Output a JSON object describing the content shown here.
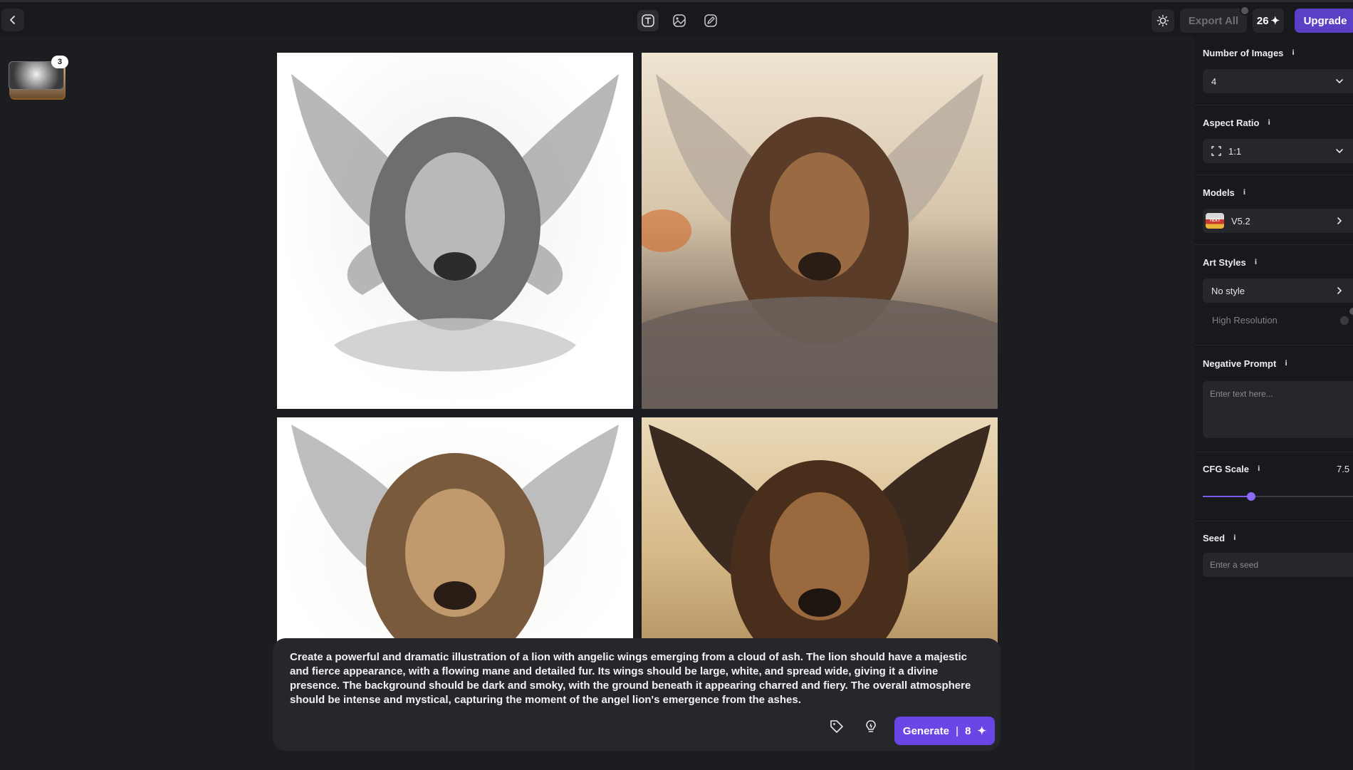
{
  "toolbar": {
    "export_label": "Export All",
    "credits": "26",
    "upgrade_label": "Upgrade",
    "modes": [
      "text-to-image-icon",
      "image-to-image-icon",
      "sketch-icon"
    ]
  },
  "history": {
    "count": "3"
  },
  "images": [
    {
      "name": "lion-wings-grayscale"
    },
    {
      "name": "lion-wings-sepia-clouds"
    },
    {
      "name": "lion-wings-white"
    },
    {
      "name": "lion-wings-dark-sepia"
    }
  ],
  "prompt": {
    "text": "Create a powerful and dramatic illustration of a lion with angelic wings emerging from a cloud of ash. The lion should have a majestic and fierce appearance, with a flowing mane and detailed fur. Its wings should be large, white, and spread wide, giving it a divine presence. The background should be dark and smoky, with the ground beneath it appearing charred and fiery. The overall atmosphere should be intense and mystical, capturing the moment of the angel lion's emergence from the ashes.",
    "generate_label": "Generate",
    "generate_cost": "8"
  },
  "settings": {
    "num_images": {
      "label": "Number of Images",
      "value": "4"
    },
    "aspect_ratio": {
      "label": "Aspect Ratio",
      "value": "1:1"
    },
    "models": {
      "label": "Models",
      "value": "V5.2",
      "logo_text": "TEXT"
    },
    "art_styles": {
      "label": "Art Styles",
      "value": "No style"
    },
    "high_resolution": {
      "label": "High Resolution",
      "enabled": false
    },
    "negative_prompt": {
      "label": "Negative Prompt",
      "placeholder": "Enter text here..."
    },
    "cfg_scale": {
      "label": "CFG Scale",
      "value": "7.5",
      "fraction": 0.32
    },
    "seed": {
      "label": "Seed",
      "placeholder": "Enter a seed"
    }
  },
  "colors": {
    "accent": "#6a46e6",
    "panel": "#18191c",
    "surface": "#26272b"
  }
}
